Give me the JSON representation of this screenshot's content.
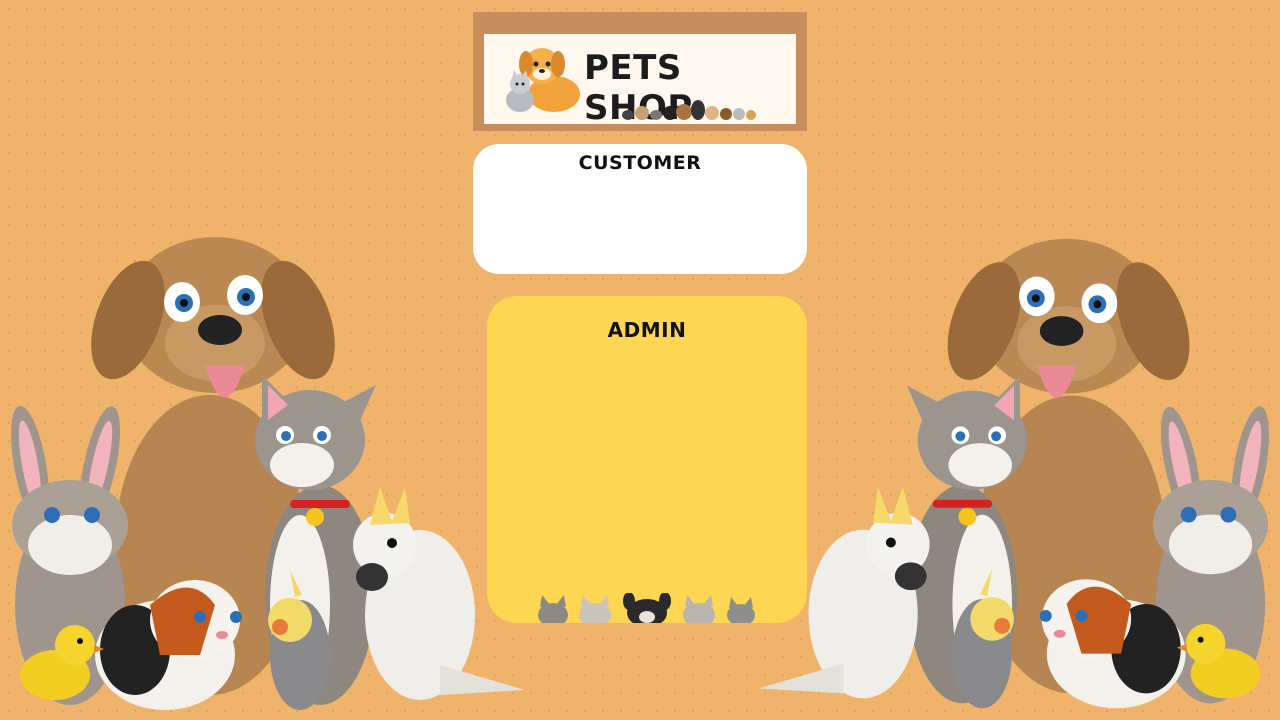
{
  "logo": {
    "text": "PETS SHOP"
  },
  "customer": {
    "label": "CUSTOMER"
  },
  "admin": {
    "label": "ADMIN"
  },
  "colors": {
    "background": "#F0B36B",
    "customer_card": "#FFFFFF",
    "admin_card": "#FDD753",
    "logo_frame": "#C68E5D"
  },
  "decor": {
    "left_group": [
      "dog",
      "cat",
      "rabbit",
      "guinea-pig",
      "cockatoo",
      "cockatiel",
      "canary"
    ],
    "right_group": [
      "dog",
      "cat",
      "rabbit",
      "guinea-pig",
      "cockatoo",
      "cockatiel",
      "canary"
    ]
  }
}
